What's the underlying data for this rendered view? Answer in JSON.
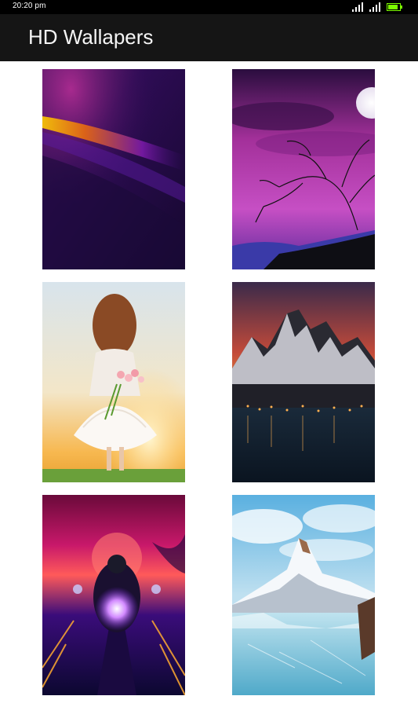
{
  "status_bar": {
    "time": "20:20 pm",
    "icons": [
      "cell-signal-icon",
      "cell-signal-icon",
      "battery-icon"
    ],
    "battery_level": 0.85
  },
  "app_bar": {
    "title": "HD Wallapers"
  },
  "wallpapers": [
    {
      "name": "purple-abstract",
      "colors": [
        "#2a0d4f",
        "#f0b400"
      ]
    },
    {
      "name": "purple-tree-moon",
      "colors": [
        "#8a2bb8",
        "#111111"
      ]
    },
    {
      "name": "girl-with-flowers",
      "colors": [
        "#f0e6d0",
        "#f0a030"
      ]
    },
    {
      "name": "mountain-lake-town",
      "colors": [
        "#c95030",
        "#102030"
      ]
    },
    {
      "name": "motorcycle-neon",
      "colors": [
        "#c0186a",
        "#3010a0"
      ]
    },
    {
      "name": "snowy-mountain-lake",
      "colors": [
        "#7ec8e3",
        "#e9f3f7"
      ]
    }
  ]
}
